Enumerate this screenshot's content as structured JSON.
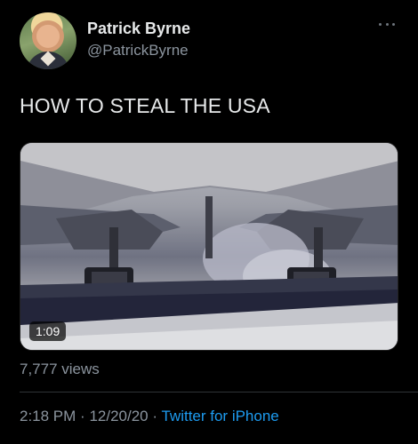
{
  "author": {
    "name": "Patrick Byrne",
    "handle": "@PatrickByrne",
    "avatar_icon": "profile-photo"
  },
  "tweet": {
    "text": "HOW TO STEAL THE USA"
  },
  "video": {
    "duration": "1:09",
    "thumbnail": "airplane-landing-gear-on-runway"
  },
  "stats": {
    "views": "7,777 views"
  },
  "meta": {
    "time": "2:18 PM",
    "separator": "·",
    "date": "12/20/20",
    "source": "Twitter for iPhone"
  },
  "colors": {
    "background": "#000000",
    "primary_text": "#e7e9ea",
    "secondary_text": "#8b949e",
    "link": "#1d9bf0"
  }
}
